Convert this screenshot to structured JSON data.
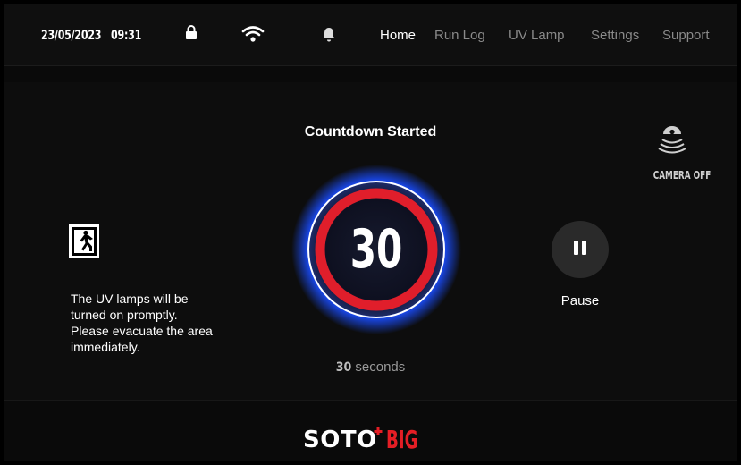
{
  "statusbar": {
    "date": "23/05/2023",
    "time": "09:31",
    "icons": [
      "lock-icon",
      "wifi-icon",
      "bell-icon"
    ]
  },
  "nav": {
    "items": [
      {
        "label": "Home",
        "active": true
      },
      {
        "label": "Run Log",
        "active": false
      },
      {
        "label": "UV Lamp",
        "active": false
      },
      {
        "label": "Settings",
        "active": false
      },
      {
        "label": "Support",
        "active": false
      }
    ]
  },
  "main": {
    "title": "Countdown Started",
    "warning_lines": [
      "The UV lamps will be",
      "turned on promptly.",
      "Please evacuate the area",
      "immediately."
    ],
    "countdown_value": "30",
    "seconds_value": "30",
    "seconds_unit": "seconds",
    "pause_label": "Pause",
    "camera_label": "CAMERA OFF"
  },
  "footer": {
    "logo_part1": "SOTO",
    "logo_part2": "BIG"
  },
  "colors": {
    "ring_red": "#e01e2b",
    "glow_blue": "#1a4dff",
    "logo_red": "#e41e25",
    "background": "#0d0d0d"
  }
}
